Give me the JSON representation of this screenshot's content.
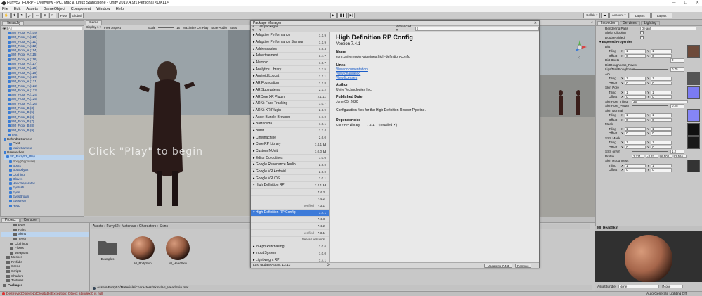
{
  "window": {
    "title": "Furry52_HDRP - Overview - PC, Mac & Linux Standalone - Unity 2019.4.9f1 Personal <DX11>",
    "controls": [
      "—",
      "☐",
      "✕"
    ]
  },
  "menu": [
    "File",
    "Edit",
    "Assets",
    "GameObject",
    "Component",
    "Window",
    "Help"
  ],
  "toolbar": {
    "pivot": "Pivot",
    "global": "Global",
    "collab": "Collab ▾",
    "account": "Account ▾",
    "layers": "Layers",
    "layout": "Layout"
  },
  "hierarchy": {
    "tab": "Hierarchy",
    "search_placeholder": "All",
    "items": [
      {
        "label": "SM_Floor_A (109)",
        "style": "blue"
      },
      {
        "label": "SM_Floor_A (110)",
        "style": "blue"
      },
      {
        "label": "SM_Floor_A (111)",
        "style": "blue"
      },
      {
        "label": "SM_Floor_A (112)",
        "style": "blue"
      },
      {
        "label": "SM_Floor_A (114)",
        "style": "blue"
      },
      {
        "label": "SM_Floor_A (115)",
        "style": "blue"
      },
      {
        "label": "SM_Floor_A (116)",
        "style": "blue"
      },
      {
        "label": "SM_Floor_A (117)",
        "style": "blue"
      },
      {
        "label": "SM_Floor_A (118)",
        "style": "blue"
      },
      {
        "label": "SM_Floor_A (119)",
        "style": "blue"
      },
      {
        "label": "SM_Floor_A (120)",
        "style": "blue"
      },
      {
        "label": "SM_Floor_A (121)",
        "style": "blue"
      },
      {
        "label": "SM_Floor_A (122)",
        "style": "blue"
      },
      {
        "label": "SM_Floor_A (123)",
        "style": "blue"
      },
      {
        "label": "SM_Floor_A (124)",
        "style": "blue"
      },
      {
        "label": "SM_Floor_A (125)",
        "style": "blue"
      },
      {
        "label": "SM_Floor_A (126)",
        "style": "blue"
      },
      {
        "label": "SM_Floor_B (3)",
        "style": "blue"
      },
      {
        "label": "SM_Floor_B (5)",
        "style": "blue"
      },
      {
        "label": "SM_Floor_B (6)",
        "style": "blue"
      },
      {
        "label": "SM_Floor_B (7)",
        "style": "blue"
      },
      {
        "label": "SM_Floor_B (8)",
        "style": "blue"
      },
      {
        "label": "SM_Floor_B (9)",
        "style": "blue"
      },
      {
        "label": "Text",
        "style": "blue"
      },
      {
        "label": "Behind52Camera",
        "style": "blk"
      },
      {
        "label": "Pivot",
        "style": "blk"
      },
      {
        "label": "Main Camera",
        "style": "blue"
      },
      {
        "label": "UseMeshes",
        "style": "blk"
      },
      {
        "label": "SK_Furry52_Play",
        "style": "sel"
      },
      {
        "label": "Body(Opposite)",
        "style": "grey"
      },
      {
        "label": "Boots",
        "style": "blue"
      },
      {
        "label": "BotBody52",
        "style": "blue"
      },
      {
        "label": "Clothing",
        "style": "blue"
      },
      {
        "label": "Gloves",
        "style": "blue"
      },
      {
        "label": "HeadSeparates",
        "style": "blue"
      },
      {
        "label": "Eyelash",
        "style": "blue"
      },
      {
        "label": "Eyes",
        "style": "blue"
      },
      {
        "label": "EyesBrown",
        "style": "blue"
      },
      {
        "label": "EyesTear",
        "style": "blue"
      },
      {
        "label": "Head",
        "style": "blue"
      }
    ]
  },
  "game": {
    "tab": "Game",
    "display": "Display 1 ▾",
    "aspect": "Free Aspect",
    "scale_label": "Scale",
    "scale_value": "1x",
    "maximize": "Maximize On Play",
    "mute": "Mute Audio",
    "stats": "Stats",
    "overlay_text": "Click \"Play\" to begin"
  },
  "package_manager": {
    "title": "Package Manager",
    "filter": "All packages ▾",
    "advanced": "Advanced ▾",
    "list": [
      {
        "name": "Adaptive Performance",
        "version": "1.1.9"
      },
      {
        "name": "Adaptive Performance Samsun",
        "version": "1.1.9"
      },
      {
        "name": "Addressables",
        "version": "1.8.4"
      },
      {
        "name": "Advertisement",
        "version": "3.4.7"
      },
      {
        "name": "Alembic",
        "version": "1.0.7"
      },
      {
        "name": "Analytics Library",
        "version": "3.3.5"
      },
      {
        "name": "Android Logcat",
        "version": "1.1.1"
      },
      {
        "name": "AR Foundation",
        "version": "2.1.8"
      },
      {
        "name": "AR Subsystems",
        "version": "2.1.2"
      },
      {
        "name": "ARCore XR Plugin",
        "version": "2.1.11"
      },
      {
        "name": "ARKit Face Tracking",
        "version": "1.0.7"
      },
      {
        "name": "ARKit XR Plugin",
        "version": "2.1.9"
      },
      {
        "name": "Asset Bundle Browser",
        "version": "1.7.0"
      },
      {
        "name": "Barracuda",
        "version": "1.0.1"
      },
      {
        "name": "Burst",
        "version": "1.3.4"
      },
      {
        "name": "Cinemachine",
        "version": "2.6.0"
      },
      {
        "name": "Core RP Library",
        "version": "7.4.1",
        "installed": true
      },
      {
        "name": "Custom NUnit",
        "version": "1.0.0",
        "installed": true
      },
      {
        "name": "Editor Coroutines",
        "version": "1.0.0"
      },
      {
        "name": "Google Resonance Audio",
        "version": "2.0.0"
      },
      {
        "name": "Google VR Android",
        "version": "2.0.0"
      },
      {
        "name": "Google VR iOS",
        "version": "2.0.1"
      },
      {
        "name": "High Definition RP",
        "version": "7.4.1",
        "installed": true,
        "expanded": true
      },
      {
        "sub": "7.4.3"
      },
      {
        "sub": "7.4.2"
      },
      {
        "sub": "7.3.1",
        "label": "verified"
      },
      {
        "name": "High Definition RP Config",
        "version": "7.4.1",
        "selected": true
      },
      {
        "sub": "7.4.3"
      },
      {
        "sub": "7.4.2"
      },
      {
        "sub": "7.3.1",
        "label": "verified"
      },
      {
        "sub": "See all versions"
      },
      {
        "name": "In App Purchasing",
        "version": "2.0.6"
      },
      {
        "name": "Input System",
        "version": "1.0.0"
      },
      {
        "name": "Lightweight RP",
        "version": "7.4.1"
      }
    ],
    "footer": {
      "last_update": "Last update Aug 8, 13:13",
      "update_button": "Update to 7.4.3",
      "remove_button": "Remove"
    },
    "detail": {
      "name": "High Definition RP Config",
      "version": "Version 7.4.1",
      "name_label": "Name",
      "package_id": "com.unity.render-pipelines.high-definition-config",
      "links_label": "Links",
      "links": [
        "View documentation",
        "View changelog",
        "View licenses"
      ],
      "author_label": "Author",
      "author": "Unity Technologies Inc.",
      "published_label": "Published Date",
      "published": "June 05,  2020",
      "description": "Configuration files for the High Definition Render Pipeline.",
      "deps_label": "Dependencies",
      "dep_name": "Core RP Library",
      "dep_version": "7.4.1",
      "dep_status": "(Installed ✔)"
    }
  },
  "inspector": {
    "tabs": [
      "Inspector",
      "Services",
      "Lighting"
    ],
    "rendering_pass_label": "Rendering Pass",
    "rendering_pass_value": "Default",
    "alpha_clipping": "Alpha Clipping",
    "double_sided": "Double-Sided",
    "exposed_header": "Exposed Properties",
    "groups": [
      {
        "name": "Dirt",
        "tiling": [
          "1",
          "1"
        ],
        "offset": [
          "0",
          "0"
        ],
        "swatch": "#6d4a3a"
      },
      {
        "name": "AO",
        "tiling": [
          "1",
          "1"
        ],
        "offset": [
          "0",
          "0"
        ],
        "swatch": "#555"
      },
      {
        "name": "Skin Pore",
        "tiling": [
          "1",
          "1"
        ],
        "offset": [
          "0",
          "0"
        ],
        "swatch": "#7b7bf2"
      },
      {
        "name": "Skin Normal",
        "tiling": [
          "1",
          "1"
        ],
        "offset": [
          "0",
          "0"
        ],
        "swatch": "#8585f6"
      },
      {
        "name": "Mask",
        "tiling": [
          "1",
          "1"
        ],
        "offset": [
          "0",
          "0"
        ],
        "swatch": "#111"
      },
      {
        "name": "SSS Mask",
        "tiling": [
          "1",
          "1"
        ],
        "offset": [
          "0",
          "0"
        ],
        "swatch": "#1a1a1a"
      },
      {
        "name": "Skin Roughness",
        "tiling": [
          "1",
          "1"
        ],
        "offset": [
          "0",
          "0"
        ],
        "swatch": "#333"
      }
    ],
    "dirt_boots_label": "Dirt Boots",
    "dirt_boots_value": "0",
    "dirt_rough_label": "DirtRoughness_Power",
    "dirt_rough_value": "0",
    "lips_label": "Lips/Nail Roughness",
    "lips_value": "0.75",
    "pore_tiling_label": "SkinPore_Tiling",
    "pore_tiling_value": "35",
    "pore_power_label": "SkinPore_Power",
    "pore_power_value": "0.25",
    "sss_label": "SSS on/off",
    "sss_value": "1.2",
    "profile_label": "Profile",
    "profile_values": [
      "2.721",
      "-3.37",
      "6.503",
      "2.516"
    ],
    "preview_title": "MI_HeadSkin",
    "asset_bundle_label": "AssetBundle",
    "asset_bundle_value": "None",
    "asset_bundle_variant": "None"
  },
  "project": {
    "tabs": [
      "Project",
      "Console"
    ],
    "tree": [
      {
        "label": "Eyes",
        "indent": 3
      },
      {
        "label": "Hairs",
        "indent": 3
      },
      {
        "label": "Skins",
        "indent": 3,
        "selected": true
      },
      {
        "label": "Teeth",
        "indent": 3
      },
      {
        "label": "Clothings",
        "indent": 2
      },
      {
        "label": "Floors",
        "indent": 2
      },
      {
        "label": "Weapons",
        "indent": 2
      },
      {
        "label": "Meshes",
        "indent": 1
      },
      {
        "label": "Prefabs",
        "indent": 1
      },
      {
        "label": "Scene",
        "indent": 1
      },
      {
        "label": "Scripts",
        "indent": 1
      },
      {
        "label": "Shaders",
        "indent": 1
      },
      {
        "label": "Textures",
        "indent": 1
      },
      {
        "label": "Packages",
        "indent": 0
      }
    ],
    "breadcrumb": "Assets › Furry52 › Materials › Characters › Skins",
    "assets": [
      "Examples",
      "MI_BodySkin",
      "MI_HeadSkin"
    ],
    "path": "Assets/Furry52/Materials/Characters/Skins/MI_HeadSkin.mat",
    "asset_count": "15"
  },
  "status": {
    "error": "DestroyedObjectNotCreatableException: Object at index 0 is null",
    "right": "Auto Generate Lighting Off"
  }
}
